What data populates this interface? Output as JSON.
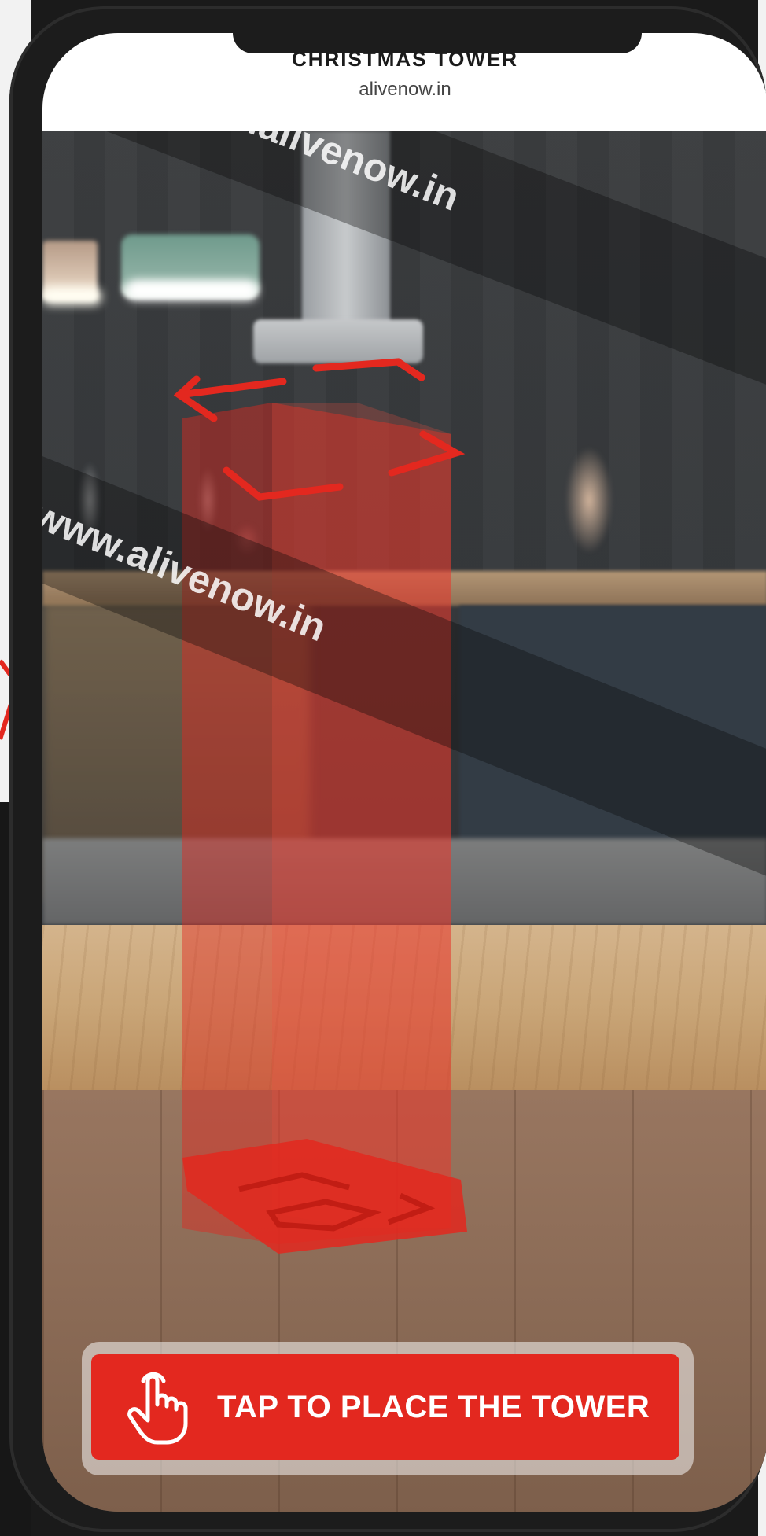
{
  "app": {
    "title": "CHRISTMAS TOWER",
    "url": "alivenow.in"
  },
  "watermark": {
    "text": "www.alivenow.in"
  },
  "cta": {
    "label": "TAP TO PLACE THE TOWER",
    "icon": "tap-hand-icon"
  },
  "colors": {
    "accent": "#e3281f",
    "ar_guide": "#e3281f",
    "header_bg": "#ffffff"
  }
}
